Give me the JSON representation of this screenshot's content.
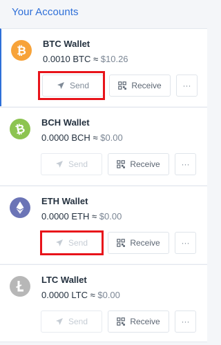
{
  "header": {
    "title": "Your Accounts"
  },
  "accounts": [
    {
      "name": "BTC Wallet",
      "balance": "0.0010 BTC",
      "approx": "≈",
      "fiat": "$10.26",
      "coin_color": "#f7a33a",
      "icon": "bitcoin-icon"
    },
    {
      "name": "BCH Wallet",
      "balance": "0.0000 BCH",
      "approx": "≈",
      "fiat": "$0.00",
      "coin_color": "#8dc451",
      "icon": "bitcoin-cash-icon"
    },
    {
      "name": "ETH Wallet",
      "balance": "0.0000 ETH",
      "approx": "≈",
      "fiat": "$0.00",
      "coin_color": "#6b74b6",
      "icon": "ethereum-icon"
    },
    {
      "name": "LTC Wallet",
      "balance": "0.0000 LTC",
      "approx": "≈",
      "fiat": "$0.00",
      "coin_color": "#b7b7b7",
      "icon": "litecoin-icon"
    }
  ],
  "buttons": {
    "send": "Send",
    "receive": "Receive",
    "more": "···"
  },
  "colors": {
    "accent": "#2e6fd8",
    "highlight": "#e8131a"
  }
}
